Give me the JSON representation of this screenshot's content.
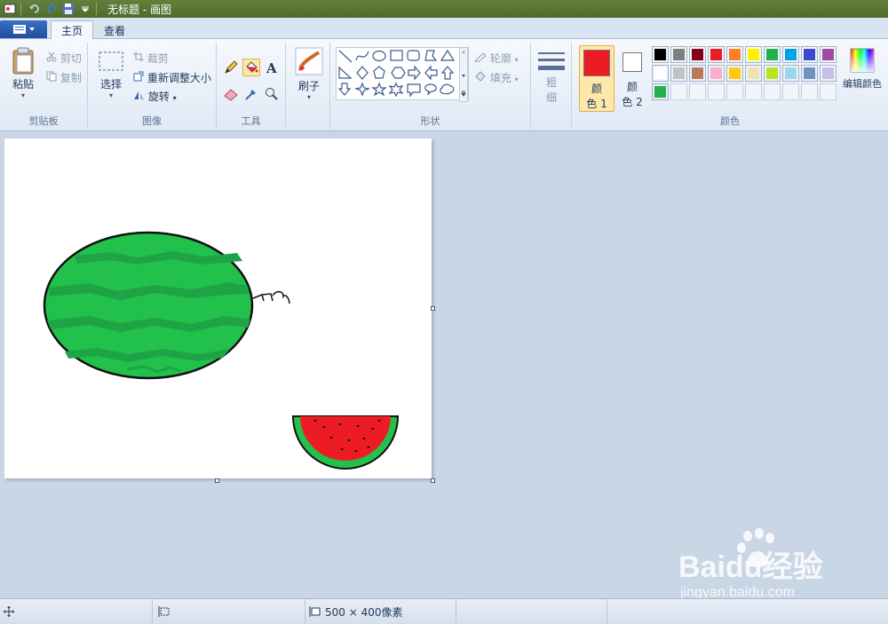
{
  "window": {
    "title": "无标题 - 画图"
  },
  "tabs": [
    {
      "label": "主页",
      "active": true
    },
    {
      "label": "查看",
      "active": false
    }
  ],
  "clipboard": {
    "paste": "粘贴",
    "cut": "剪切",
    "copy": "复制",
    "group": "剪贴板"
  },
  "image": {
    "select": "选择",
    "crop": "裁剪",
    "resize": "重新调整大小",
    "rotate": "旋转",
    "group": "图像"
  },
  "tools": {
    "group": "工具",
    "active": "fill-bucket"
  },
  "brushes": {
    "label": "刷子"
  },
  "shapes": {
    "outline": "轮廓",
    "fill": "填充",
    "group": "形状"
  },
  "size": {
    "label1": "粗",
    "label2": "细"
  },
  "colors": {
    "color1_label1": "颜",
    "color1_label2": "色 1",
    "color1": "#ed1c24",
    "color2_label1": "颜",
    "color2_label2": "色 2",
    "color2": "#ffffff",
    "edit": "编辑颜色",
    "group": "颜色",
    "palette_row1": [
      "#000000",
      "#7f7f7f",
      "#880015",
      "#ed1c24",
      "#ff7f27",
      "#fff200",
      "#22b14c",
      "#00a2e8",
      "#3f48cc",
      "#a349a4"
    ],
    "palette_row2": [
      "#ffffff",
      "#c3c3c3",
      "#b97a57",
      "#ffaec9",
      "#ffc90e",
      "#efe4b0",
      "#b5e61d",
      "#99d9ea",
      "#7092be",
      "#c8bfe7"
    ],
    "palette_row3": [
      "#22b14c"
    ]
  },
  "status": {
    "canvas_size": "500 × 400像素"
  },
  "watermark": {
    "brand": "Baidu经验",
    "url": "jingyan.baidu.com"
  }
}
